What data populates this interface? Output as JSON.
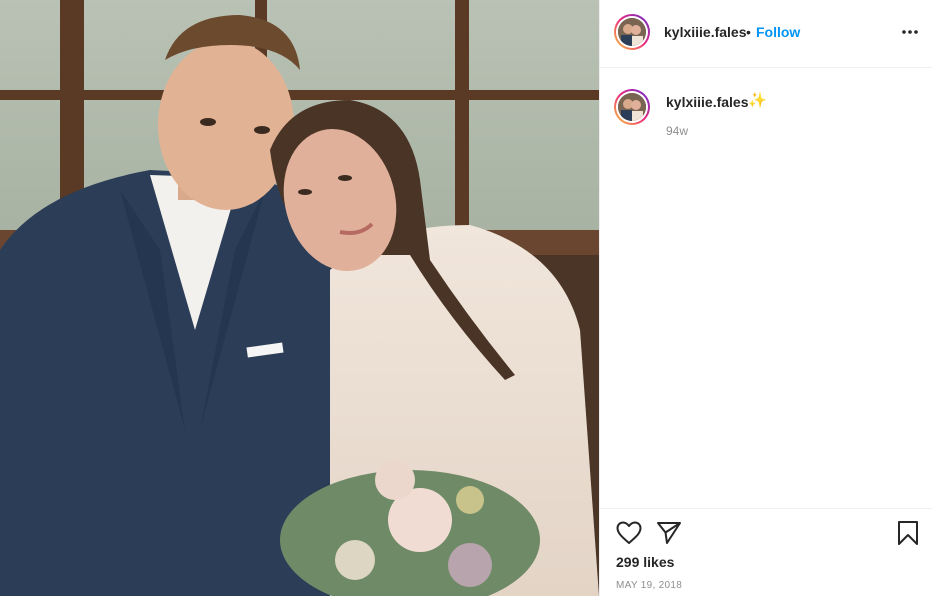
{
  "post": {
    "username": "kylxiiie.fales",
    "separator": "•",
    "follow_label": "Follow",
    "more_icon": "more-options-icon",
    "caption_emoji": "✨",
    "time_ago": "94w",
    "likes_text": "299 likes",
    "date": "MAY 19, 2018"
  },
  "icons": {
    "like": "heart-icon",
    "share": "paper-plane-icon",
    "save": "bookmark-icon"
  },
  "colors": {
    "link_blue": "#0095f6",
    "text": "#262626",
    "muted": "#8e8e8e",
    "border": "#efefef"
  }
}
